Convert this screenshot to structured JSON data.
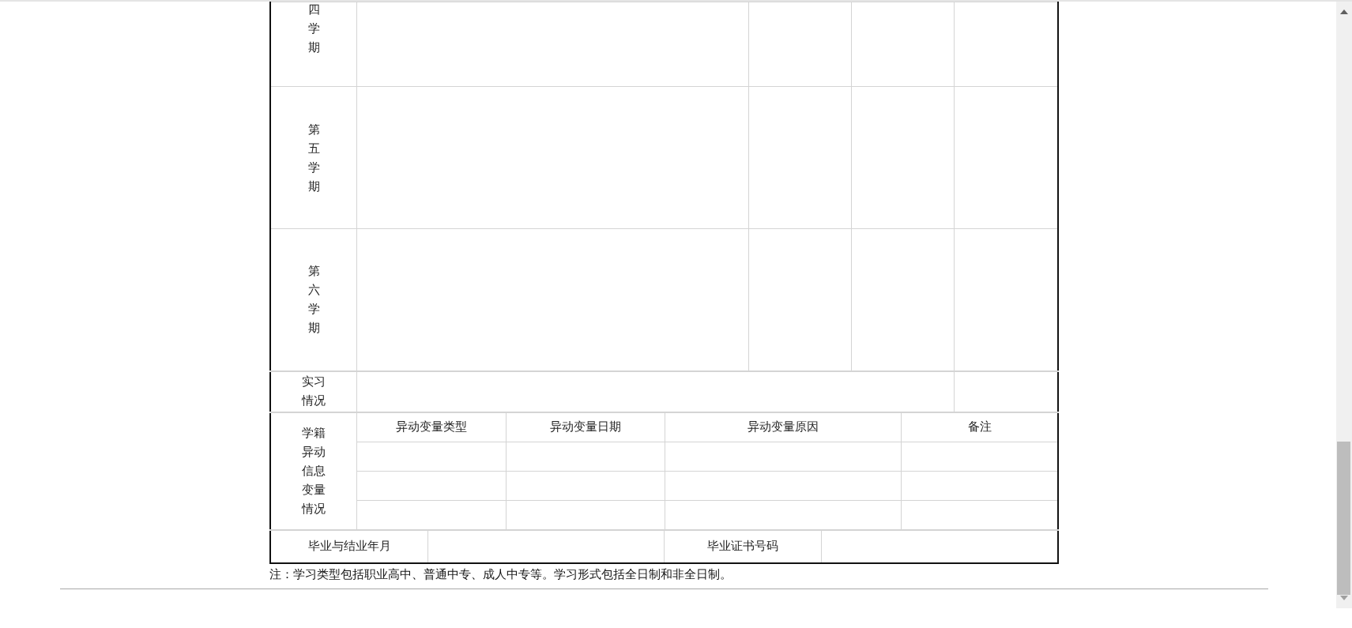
{
  "semesters": [
    {
      "label": "四学期"
    },
    {
      "label": "第五学期"
    },
    {
      "label": "第六学期"
    }
  ],
  "internship": {
    "label": "实习情况"
  },
  "status_change": {
    "label_lines": [
      "学籍",
      "异动",
      "信息",
      "变量",
      "情况"
    ],
    "columns": [
      "异动变量类型",
      "异动变量日期",
      "异动变量原因",
      "备注"
    ]
  },
  "graduation": {
    "labels": [
      "毕业与结业年月",
      "毕业证书号码"
    ]
  },
  "note": "注：学习类型包括职业高中、普通中专、成人中专等。学习形式包括全日制和非全日制。"
}
